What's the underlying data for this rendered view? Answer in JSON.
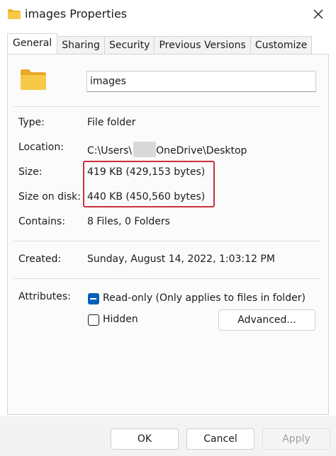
{
  "window": {
    "title": "images Properties",
    "title_icon": "folder-icon",
    "close_icon": "close-icon"
  },
  "tabs": [
    {
      "label": "General",
      "active": true
    },
    {
      "label": "Sharing",
      "active": false
    },
    {
      "label": "Security",
      "active": false
    },
    {
      "label": "Previous Versions",
      "active": false
    },
    {
      "label": "Customize",
      "active": false
    }
  ],
  "general": {
    "folder_icon": "folder-icon",
    "name_value": "images",
    "type_label": "Type:",
    "type_value": "File folder",
    "location_label": "Location:",
    "location_prefix": "C:\\Users\\",
    "location_suffix": "OneDrive\\Desktop",
    "size_label": "Size:",
    "size_value": "419 KB (429,153 bytes)",
    "size_on_disk_label": "Size on disk:",
    "size_on_disk_value": "440 KB (450,560 bytes)",
    "contains_label": "Contains:",
    "contains_value": "8 Files, 0 Folders",
    "created_label": "Created:",
    "created_value": "Sunday, August 14, 2022, 1:03:12 PM",
    "attributes_label": "Attributes:",
    "readonly_label": "Read-only (Only applies to files in folder)",
    "readonly_checked": true,
    "hidden_label": "Hidden",
    "hidden_checked": false,
    "advanced_label": "Advanced..."
  },
  "buttons": {
    "ok": "OK",
    "cancel": "Cancel",
    "apply": "Apply"
  },
  "colors": {
    "accent": "#005fb8",
    "highlight": "#c8303c",
    "folder": "#f7c948"
  }
}
